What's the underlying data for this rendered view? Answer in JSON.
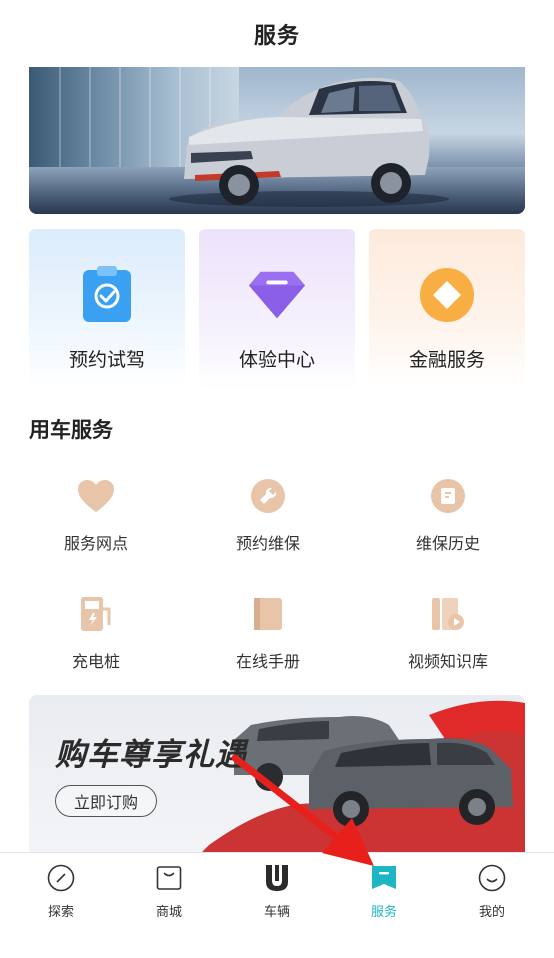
{
  "header": {
    "title": "服务"
  },
  "cards": [
    {
      "label": "预约试驾",
      "icon": "clipboard-check-icon"
    },
    {
      "label": "体验中心",
      "icon": "diamond-icon"
    },
    {
      "label": "金融服务",
      "icon": "finance-coin-icon"
    }
  ],
  "section": {
    "title": "用车服务"
  },
  "services": [
    {
      "label": "服务网点",
      "icon": "heart-icon"
    },
    {
      "label": "预约维保",
      "icon": "wrench-icon"
    },
    {
      "label": "维保历史",
      "icon": "history-icon"
    },
    {
      "label": "充电桩",
      "icon": "charging-pile-icon"
    },
    {
      "label": "在线手册",
      "icon": "manual-book-icon"
    },
    {
      "label": "视频知识库",
      "icon": "video-library-icon"
    }
  ],
  "promo": {
    "title": "购车尊享礼遇",
    "button_label": "立即订购"
  },
  "tabbar": {
    "active": "服务",
    "accent_color": "#1fb6c4",
    "tabs": [
      {
        "label": "探索",
        "icon": "compass-icon"
      },
      {
        "label": "商城",
        "icon": "shopping-bag-icon"
      },
      {
        "label": "车辆",
        "icon": "vehicle-logo-icon"
      },
      {
        "label": "服务",
        "icon": "service-bookmark-icon"
      },
      {
        "label": "我的",
        "icon": "profile-smile-icon"
      }
    ]
  }
}
